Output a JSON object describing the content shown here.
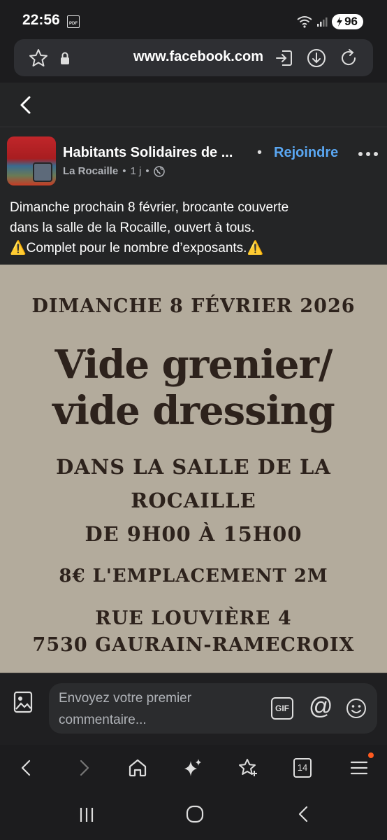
{
  "status_bar": {
    "time": "22:56",
    "pdf_label": "PDF",
    "battery": "96"
  },
  "url_bar": {
    "url": "www.facebook.com"
  },
  "post": {
    "group_name": "Habitants Solidaires de ...",
    "separator": "•",
    "join_label": "Rejoindre",
    "more_label": "•••",
    "subgroup": "La Rocaille",
    "time_ago": "1 j",
    "text_line1": "Dimanche prochain 8 février, brocante couverte",
    "text_line2": "dans la salle de la Rocaille, ouvert à tous.",
    "text_line3": "Complet pour le nombre d’exposants.",
    "warning_emoji": "⚠️"
  },
  "poster": {
    "date": "DIMANCHE 8 FÉVRIER 2026",
    "title_line1": "Vide grenier/",
    "title_line2": "vide dressing",
    "place_line1": "DANS LA SALLE DE LA",
    "place_line2": "ROCAILLE",
    "hours": "DE 9H00 À 15H00",
    "price": "8€ L'EMPLACEMENT 2M",
    "address_line1": "RUE LOUVIÈRE 4",
    "address_line2": "7530 GAURAIN-RAMECROIX"
  },
  "comment_bar": {
    "placeholder": "Envoyez votre premier commentaire...",
    "gif_label": "GIF",
    "at_label": "@"
  },
  "browser_nav": {
    "tab_count": "14"
  },
  "colors": {
    "background": "#1c1c1e",
    "card": "#242526",
    "link_blue": "#5aa7f2",
    "poster_bg": "#b3ab9c",
    "poster_text": "#2d221c",
    "notification_dot": "#ff5a1f"
  }
}
